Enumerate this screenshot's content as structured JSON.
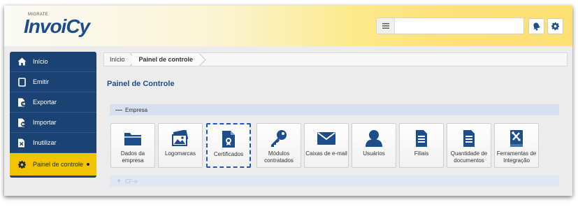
{
  "header": {
    "logo_prefix": "MIGRATE",
    "logo": "InvoiCy",
    "search": {
      "value": "",
      "placeholder": ""
    }
  },
  "sidebar": {
    "items": [
      {
        "label": "Início",
        "icon": "home-icon"
      },
      {
        "label": "Emitir",
        "icon": "document-icon"
      },
      {
        "label": "Exportar",
        "icon": "export-icon"
      },
      {
        "label": "Importar",
        "icon": "import-icon"
      },
      {
        "label": "Inutilizar",
        "icon": "void-document-icon"
      },
      {
        "label": "Painel de controle",
        "icon": "gear-icon",
        "active": true
      }
    ]
  },
  "breadcrumb": {
    "home": "Início",
    "current": "Painel de controle"
  },
  "main": {
    "title": "Painel de Controle",
    "sections": [
      {
        "label": "Empresa",
        "sign": "—",
        "expanded": true
      },
      {
        "label": "CF-e",
        "sign": "+",
        "expanded": false
      }
    ],
    "tiles": [
      {
        "label": "Dados da\nempresa",
        "icon": "folder-icon"
      },
      {
        "label": "Logomarcas",
        "icon": "image-icon"
      },
      {
        "label": "Certificados",
        "icon": "certificate-icon",
        "selected": true
      },
      {
        "label": "Módulos\ncontratados",
        "icon": "key-icon"
      },
      {
        "label": "Caixas de e-mail",
        "icon": "envelope-icon"
      },
      {
        "label": "Usuários",
        "icon": "user-icon"
      },
      {
        "label": "Filiais",
        "icon": "document-list-icon"
      },
      {
        "label": "Quantidade de\ndocumentos",
        "icon": "document-list-icon"
      },
      {
        "label": "Ferramentas de\nIntegração",
        "icon": "tools-book-icon"
      }
    ]
  },
  "colors": {
    "brand_blue": "#1e4d8c",
    "sidebar_bg": "#1a4373",
    "active_item": "#f3c300",
    "section_bar": "#d5e1ee",
    "selection_dash": "#1f55c8"
  }
}
